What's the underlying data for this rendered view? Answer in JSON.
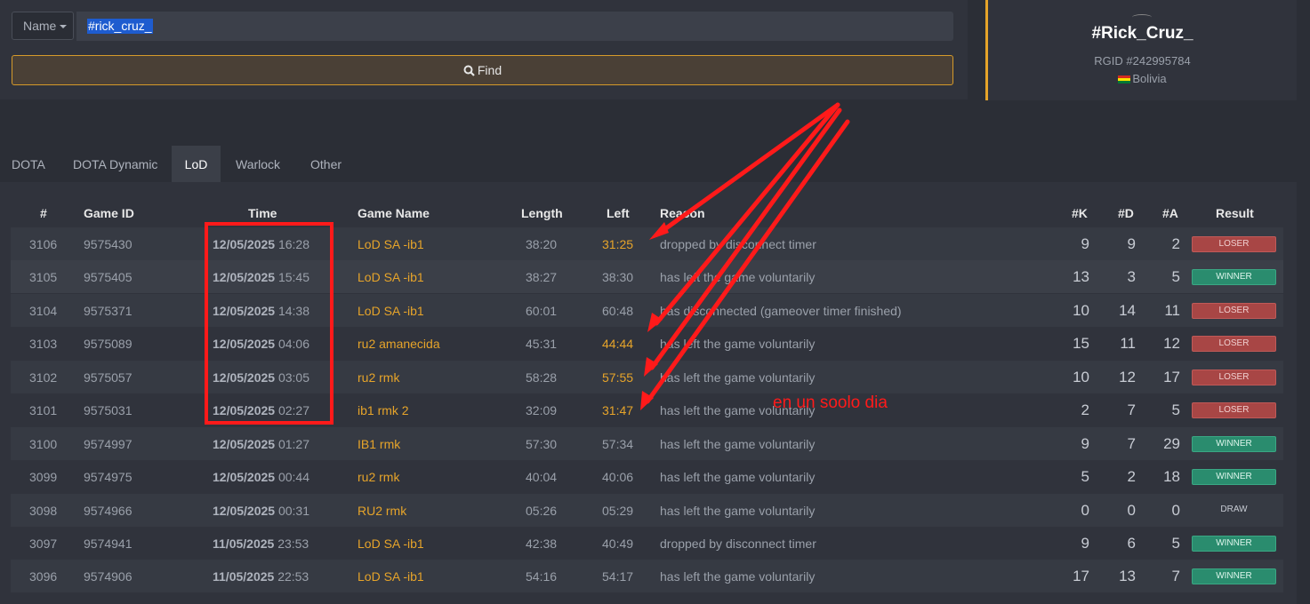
{
  "search": {
    "field_type": "Name",
    "query": "#rick_cruz_",
    "find_label": "Find"
  },
  "profile": {
    "name": "#Rick_Cruz_",
    "rgid": "RGID #242995784",
    "country": "Bolivia"
  },
  "tabs": [
    {
      "label": "DOTA",
      "active": false
    },
    {
      "label": "DOTA Dynamic",
      "active": false
    },
    {
      "label": "LoD",
      "active": true
    },
    {
      "label": "Warlock",
      "active": false
    },
    {
      "label": "Other",
      "active": false
    }
  ],
  "table": {
    "headers": {
      "num": "#",
      "game_id": "Game ID",
      "time": "Time",
      "game_name": "Game Name",
      "length": "Length",
      "left": "Left",
      "reason": "Reason",
      "k": "#K",
      "d": "#D",
      "a": "#A",
      "result": "Result"
    },
    "rows": [
      {
        "num": "3106",
        "game_id": "9575430",
        "date": "12/05/2025",
        "time": "16:28",
        "game_name": "LoD SA -ib1",
        "length": "38:20",
        "left": "31:25",
        "left_early": true,
        "reason": "dropped by disconnect timer",
        "k": "9",
        "d": "9",
        "a": "2",
        "result": "LOSER"
      },
      {
        "num": "3105",
        "game_id": "9575405",
        "date": "12/05/2025",
        "time": "15:45",
        "game_name": "LoD SA -ib1",
        "length": "38:27",
        "left": "38:30",
        "left_early": false,
        "reason": "has left the game voluntarily",
        "k": "13",
        "d": "3",
        "a": "5",
        "result": "WINNER"
      },
      {
        "num": "3104",
        "game_id": "9575371",
        "date": "12/05/2025",
        "time": "14:38",
        "game_name": "LoD SA -ib1",
        "length": "60:01",
        "left": "60:48",
        "left_early": false,
        "reason": "has disconnected (gameover timer finished)",
        "k": "10",
        "d": "14",
        "a": "11",
        "result": "LOSER"
      },
      {
        "num": "3103",
        "game_id": "9575089",
        "date": "12/05/2025",
        "time": "04:06",
        "game_name": "ru2 amanecida",
        "length": "45:31",
        "left": "44:44",
        "left_early": true,
        "reason": "has left the game voluntarily",
        "k": "15",
        "d": "11",
        "a": "12",
        "result": "LOSER"
      },
      {
        "num": "3102",
        "game_id": "9575057",
        "date": "12/05/2025",
        "time": "03:05",
        "game_name": "ru2 rmk",
        "length": "58:28",
        "left": "57:55",
        "left_early": true,
        "reason": "has left the game voluntarily",
        "k": "10",
        "d": "12",
        "a": "17",
        "result": "LOSER"
      },
      {
        "num": "3101",
        "game_id": "9575031",
        "date": "12/05/2025",
        "time": "02:27",
        "game_name": "ib1 rmk 2",
        "length": "32:09",
        "left": "31:47",
        "left_early": true,
        "reason": "has left the game voluntarily",
        "k": "2",
        "d": "7",
        "a": "5",
        "result": "LOSER"
      },
      {
        "num": "3100",
        "game_id": "9574997",
        "date": "12/05/2025",
        "time": "01:27",
        "game_name": "IB1 rmk",
        "length": "57:30",
        "left": "57:34",
        "left_early": false,
        "reason": "has left the game voluntarily",
        "k": "9",
        "d": "7",
        "a": "29",
        "result": "WINNER"
      },
      {
        "num": "3099",
        "game_id": "9574975",
        "date": "12/05/2025",
        "time": "00:44",
        "game_name": "ru2 rmk",
        "length": "40:04",
        "left": "40:06",
        "left_early": false,
        "reason": "has left the game voluntarily",
        "k": "5",
        "d": "2",
        "a": "18",
        "result": "WINNER"
      },
      {
        "num": "3098",
        "game_id": "9574966",
        "date": "12/05/2025",
        "time": "00:31",
        "game_name": "RU2 rmk",
        "length": "05:26",
        "left": "05:29",
        "left_early": false,
        "reason": "has left the game voluntarily",
        "k": "0",
        "d": "0",
        "a": "0",
        "result": "DRAW"
      },
      {
        "num": "3097",
        "game_id": "9574941",
        "date": "11/05/2025",
        "time": "23:53",
        "game_name": "LoD SA -ib1",
        "length": "42:38",
        "left": "40:49",
        "left_early": false,
        "reason": "dropped by disconnect timer",
        "k": "9",
        "d": "6",
        "a": "5",
        "result": "WINNER"
      },
      {
        "num": "3096",
        "game_id": "9574906",
        "date": "11/05/2025",
        "time": "22:53",
        "game_name": "LoD SA -ib1",
        "length": "54:16",
        "left": "54:17",
        "left_early": false,
        "reason": "has left the game voluntarily",
        "k": "17",
        "d": "13",
        "a": "7",
        "result": "WINNER"
      }
    ]
  },
  "annotation": {
    "note": "en un soolo dia",
    "color": "#ff1a1a"
  }
}
